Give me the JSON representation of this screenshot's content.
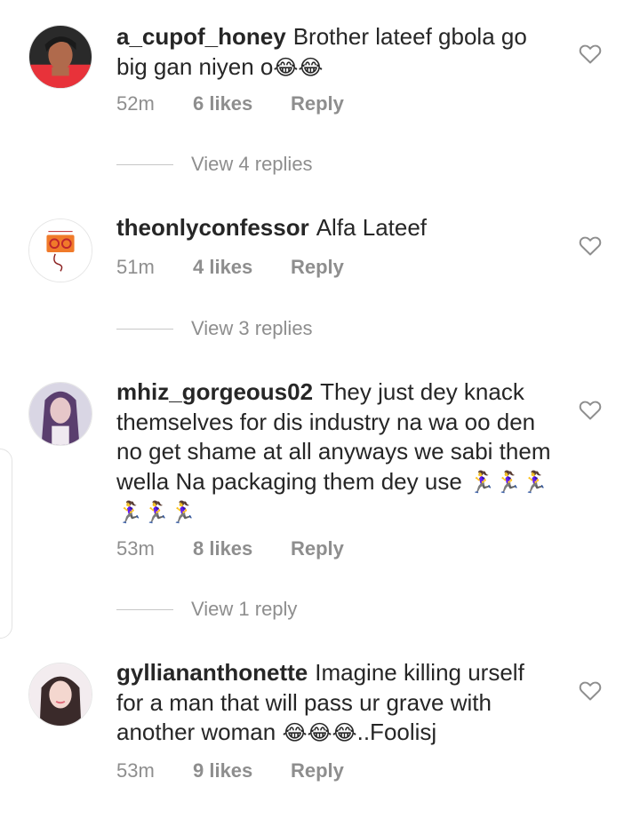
{
  "comments": [
    {
      "username": "a_cupof_honey",
      "text": "Brother lateef gbola go big gan niyen o",
      "emoji": "😂😂",
      "time": "52m",
      "likes": "6 likes",
      "reply": "Reply",
      "view_replies": "View 4 replies"
    },
    {
      "username": "theonlyconfessor",
      "text": "Alfa Lateef",
      "emoji": "",
      "time": "51m",
      "likes": "4 likes",
      "reply": "Reply",
      "view_replies": "View 3 replies"
    },
    {
      "username": "mhiz_gorgeous02",
      "text": "They just dey knack themselves for dis industry na  wa oo den no get shame at all anyways we sabi them wella Na packaging them dey use",
      "emoji": "🏃‍♀️🏃‍♀️🏃‍♀️🏃‍♀️🏃‍♀️🏃‍♀️",
      "time": "53m",
      "likes": "8 likes",
      "reply": "Reply",
      "view_replies": "View 1 reply"
    },
    {
      "username": "gylliananthonette",
      "text": "Imagine killing urself for a man that will pass ur grave with another woman",
      "emoji": "😂😂😂",
      "text_after": "..Foolisj",
      "time": "53m",
      "likes": "9 likes",
      "reply": "Reply"
    }
  ],
  "colors": {
    "primary_text": "#262626",
    "secondary_text": "#8e8e8e",
    "divider": "#c7c7c7"
  },
  "icons": {
    "like": "heart-outline-icon"
  }
}
